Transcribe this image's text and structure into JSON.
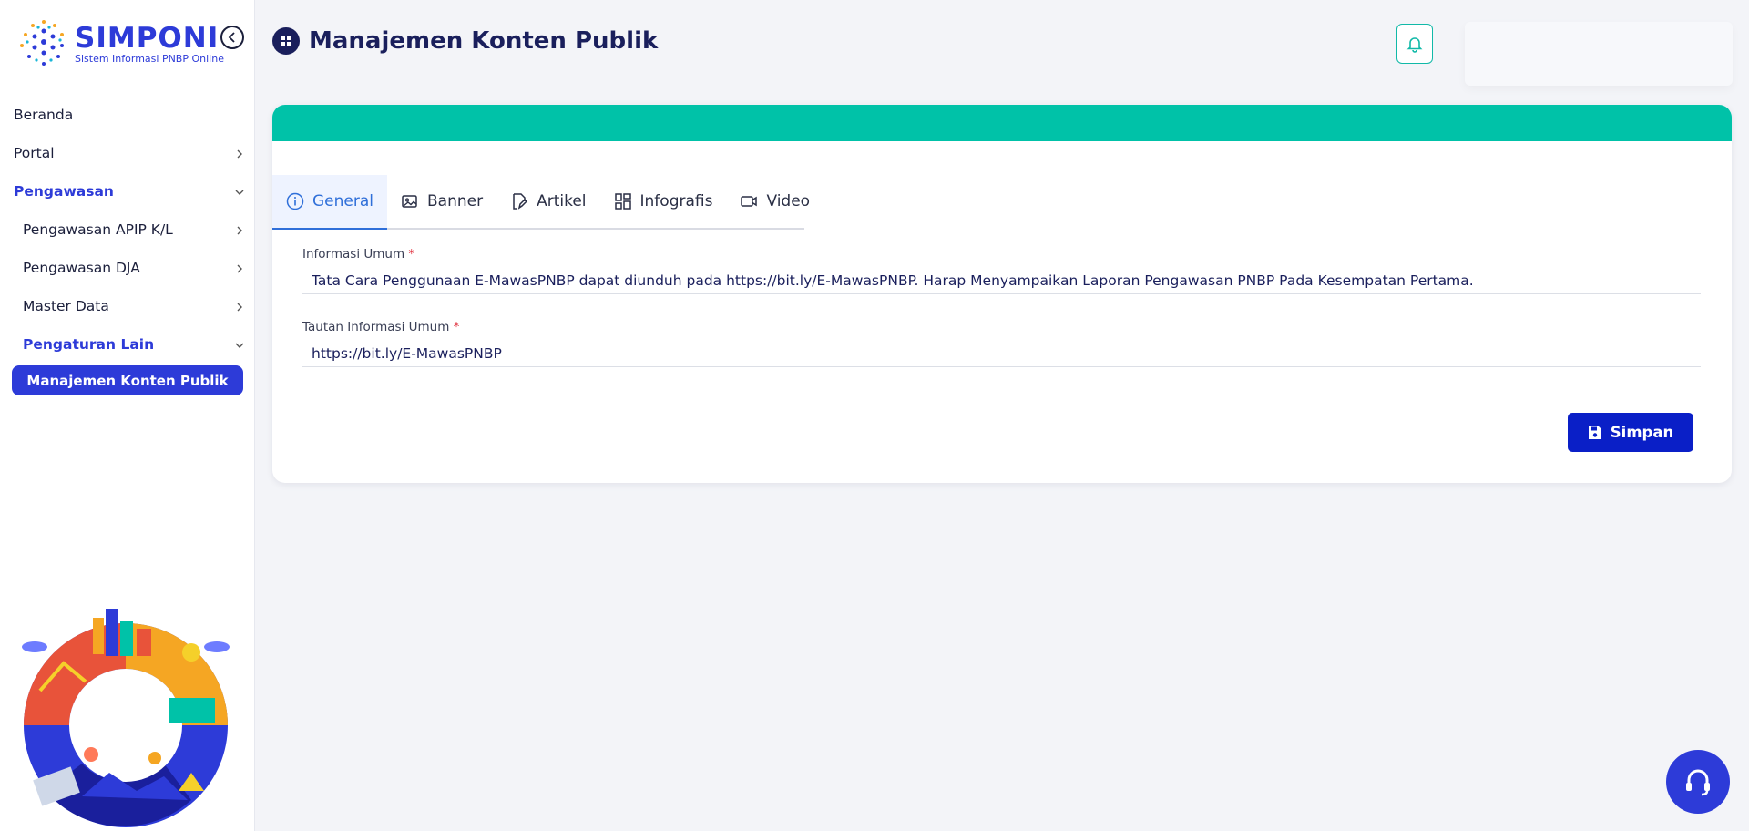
{
  "app": {
    "logo_title": "SIMPONI",
    "logo_subtitle": "Sistem Informasi PNBP Online"
  },
  "sidebar": {
    "items": [
      {
        "label": "Beranda"
      },
      {
        "label": "Portal"
      },
      {
        "label": "Pengawasan"
      },
      {
        "label": "Pengawasan APIP K/L"
      },
      {
        "label": "Pengawasan DJA"
      },
      {
        "label": "Master Data"
      },
      {
        "label": "Pengaturan Lain"
      }
    ],
    "active_item": "Manajemen Konten Publik"
  },
  "header": {
    "title": "Manajemen Konten Publik"
  },
  "tabs": [
    {
      "label": "General"
    },
    {
      "label": "Banner"
    },
    {
      "label": "Artikel"
    },
    {
      "label": "Infografis"
    },
    {
      "label": "Video"
    }
  ],
  "form": {
    "info_label": "Informasi Umum",
    "info_value": "Tata Cara Penggunaan E-MawasPNBP dapat diunduh pada https://bit.ly/E-MawasPNBP. Harap Menyampaikan Laporan Pengawasan PNBP Pada Kesempatan Pertama.",
    "link_label": "Tautan Informasi Umum",
    "link_value": "https://bit.ly/E-MawasPNBP",
    "required_mark": "*",
    "save_label": "Simpan"
  },
  "colors": {
    "primary": "#2d3bd8",
    "accent_band": "#00c2a8",
    "save_button": "#0a1fc7",
    "title": "#1a1f5c"
  }
}
